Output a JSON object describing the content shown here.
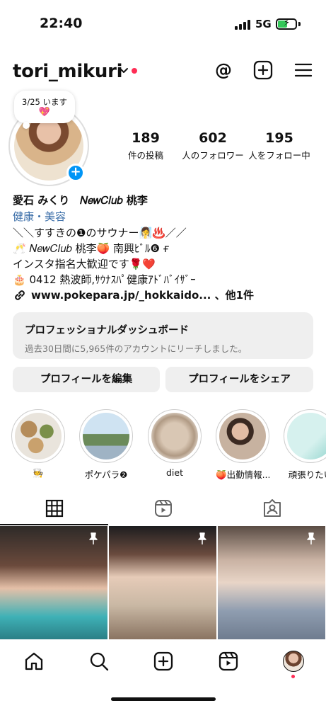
{
  "status_bar": {
    "time": "22:40",
    "network": "5G"
  },
  "header": {
    "username": "tori_mikuri"
  },
  "note": {
    "text": "3/25 います",
    "emoji": "💖"
  },
  "stats": [
    {
      "count": "189",
      "label": "件の投稿"
    },
    {
      "count": "602",
      "label": "人のフォロワー"
    },
    {
      "count": "195",
      "label": "人をフォロー中"
    }
  ],
  "bio": {
    "name": "愛石 みくり　𝑁𝑒𝑤𝐶𝑙𝑢𝑏 桃李",
    "category": "健康・美容",
    "line1": "＼＼すすきの❶のサウナー🧖‍♀️♨️／／",
    "line2": "🥂 𝑁𝑒𝑤𝐶𝑙𝑢𝑏 桃李🍑 南興ﾋﾞﾙ❻ ғ",
    "line3": "インスタ指名大歓迎です🌹❤️",
    "line4": "🎂 0412 熱波師,ｻｳﾅｽﾊﾟ健康ｱﾄﾞﾊﾞｲｻﾞｰ",
    "link": "www.pokepara.jp/_hokkaido... 、他1件"
  },
  "dashboard": {
    "title": "プロフェッショナルダッシュボード",
    "subtitle": "過去30日間に5,965件のアカウントにリーチしました。"
  },
  "buttons": {
    "edit": "プロフィールを編集",
    "share": "プロフィールをシェア"
  },
  "highlights": [
    {
      "label": "🧑‍🍳"
    },
    {
      "label": "ポケパラ❷"
    },
    {
      "label": "diet"
    },
    {
      "label": "🍑出勤情報..."
    },
    {
      "label": "頑張りたい"
    }
  ],
  "colors": {
    "accent": "#0095f6",
    "notification": "#ff2d55",
    "button_bg": "#efefef",
    "category": "#3b6ea8"
  }
}
